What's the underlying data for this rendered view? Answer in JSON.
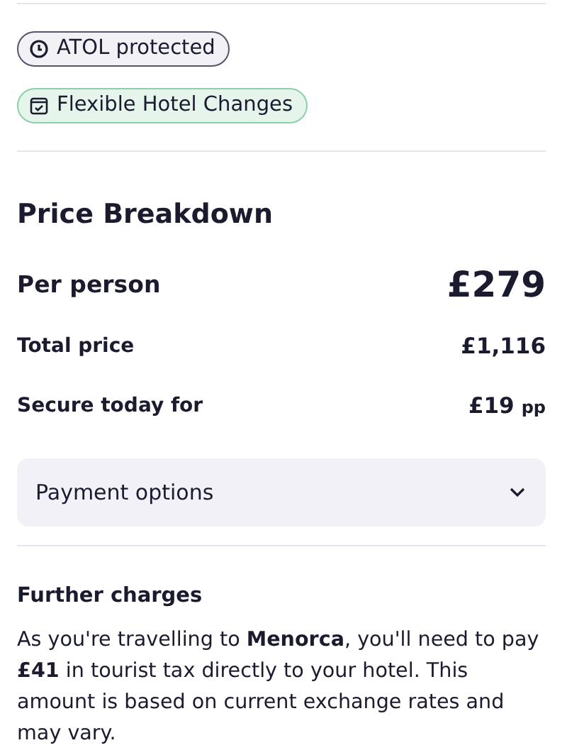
{
  "badges": [
    {
      "kind": "atol",
      "label": "ATOL protected"
    },
    {
      "kind": "flexible",
      "label": "Flexible Hotel Changes"
    }
  ],
  "price_breakdown": {
    "title": "Price Breakdown",
    "rows": [
      {
        "kind": "headline",
        "label": "Per person",
        "value": "£279"
      },
      {
        "kind": "normal",
        "label": "Total price",
        "value": "£1,116"
      },
      {
        "kind": "normal",
        "label": "Secure today for",
        "value": "£19",
        "suffix": "pp"
      }
    ],
    "payment_options": {
      "label": "Payment options",
      "expanded": false
    }
  },
  "further_charges": {
    "title": "Further charges",
    "text": "As you're travelling to **Menorca**, you'll need to pay **£41** in tourist tax directly to your hotel. This amount is based on current exchange rates and may vary."
  }
}
